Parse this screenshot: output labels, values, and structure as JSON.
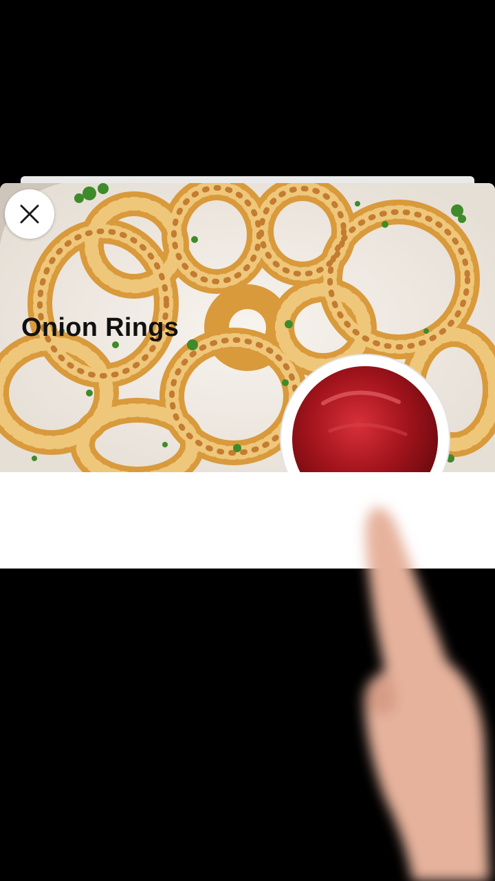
{
  "card": {
    "title": "Onion Rings",
    "photo_icon": "onion-rings-photo",
    "close_icon": "close-icon"
  },
  "colors": {
    "background": "#000000",
    "card": "#ffffff",
    "title_text": "#111111",
    "ring_crust": "#d99a3c",
    "ketchup": "#a3141c"
  }
}
